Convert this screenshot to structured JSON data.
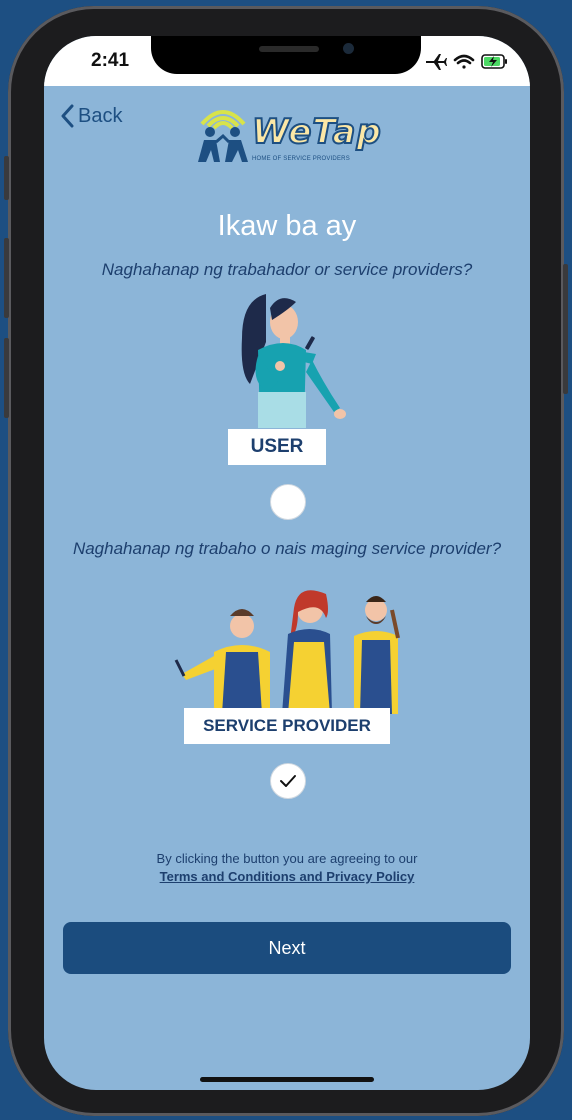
{
  "status_bar": {
    "time": "2:41",
    "icons": [
      "airplane-icon",
      "wifi-icon",
      "battery-charging-icon"
    ]
  },
  "nav": {
    "back_label": "Back"
  },
  "logo": {
    "name": "WeTap",
    "tagline": "HOME OF SERVICE PROVIDERS"
  },
  "title": "Ikaw ba ay",
  "options": [
    {
      "question": "Naghahanap ng trabahador or service providers?",
      "label": "USER",
      "selected": false
    },
    {
      "question": "Naghahanap ng trabaho o nais maging service provider?",
      "label": "SERVICE PROVIDER",
      "selected": true
    }
  ],
  "terms": {
    "text": "By clicking the button you are agreeing to our",
    "link": "Terms and Conditions and Privacy Policy"
  },
  "next_label": "Next",
  "colors": {
    "background": "#8cb5d8",
    "primary": "#1b4c7e",
    "accent": "#fbe7a6"
  }
}
